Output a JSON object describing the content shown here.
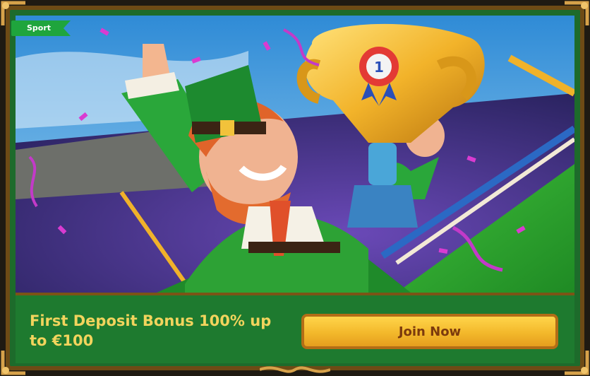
{
  "category_tag": "Sport",
  "promo": {
    "title": "First Deposit Bonus 100% up to €100",
    "cta_label": "Join Now"
  },
  "trophy_badge": "1",
  "colors": {
    "frame_gold": "#6e4b15",
    "panel_green": "#1e7a2f",
    "title_yellow": "#f2d45d",
    "button_orange": "#f3b82b",
    "tag_green": "#1fa53d"
  }
}
